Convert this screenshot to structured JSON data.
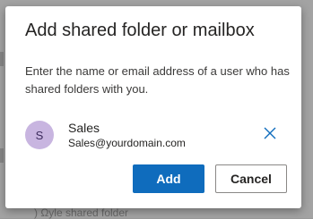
{
  "dialog": {
    "title": "Add shared folder or mailbox",
    "description": "Enter the name or email address of a user who has shared folders with you.",
    "person": {
      "initial": "S",
      "name": "Sales",
      "email": "Sales@yourdomain.com"
    },
    "add_label": "Add",
    "cancel_label": "Cancel"
  },
  "colors": {
    "primary": "#0f6cbd",
    "avatar_bg": "#c8b5e0",
    "remove_icon": "#0f6cbd"
  }
}
